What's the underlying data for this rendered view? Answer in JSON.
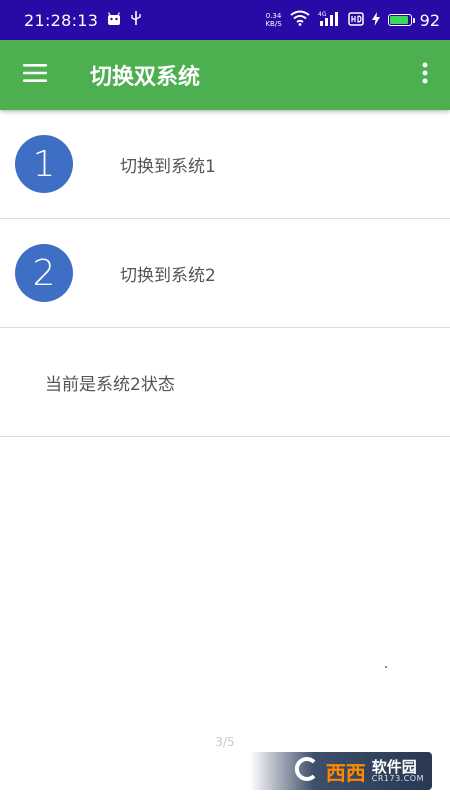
{
  "status_bar": {
    "time": "21:28:13",
    "net_speed_value": "0.34",
    "net_speed_unit": "KB/S",
    "network_type": "4G",
    "battery": "92",
    "background_color": "#2a0aa6"
  },
  "app_bar": {
    "title": "切换双系统",
    "background_color": "#4caf50",
    "menu_icon": "hamburger-menu-icon",
    "overflow_icon": "more-vertical-icon"
  },
  "list": {
    "items": [
      {
        "number": "1",
        "label": "切换到系统1"
      },
      {
        "number": "2",
        "label": "切换到系统2"
      }
    ],
    "status_text": "当前是系统2状态",
    "circle_color": "#3f6fc4"
  },
  "footer": {
    "page_indicator": "3/5",
    "watermark_brand_a": "西西",
    "watermark_brand_b": "软件园",
    "watermark_url": "CR173.COM"
  }
}
